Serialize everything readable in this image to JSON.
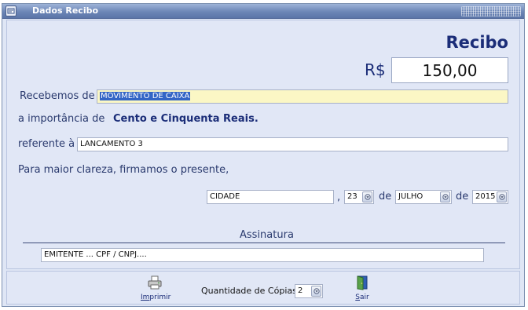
{
  "window": {
    "title": "Dados Recibo"
  },
  "header": {
    "heading": "Recibo",
    "currency_symbol": "R$",
    "amount": "150,00"
  },
  "form": {
    "received_from_label": "Recebemos de",
    "received_from_value": "MOVIMENTO DE CAIXA",
    "importance_label": "a importância de",
    "amount_in_words": "Cento e Cinquenta Reais.",
    "referring_label": "referente à",
    "referring_value": "LANCAMENTO 3",
    "clarity_text": "Para maior clareza, firmamos o presente,"
  },
  "date_line": {
    "city": "CIDADE",
    "comma": ",",
    "day": "23",
    "de1": "de",
    "month": "JULHO",
    "de2": "de",
    "year": "2015"
  },
  "signature": {
    "title": "Assinatura",
    "issuer": "EMITENTE ...  CPF / CNPJ...."
  },
  "footer": {
    "print_label_underlined": "Im",
    "print_label_rest": "primir",
    "copies_label": "Quantidade de Cópias",
    "copies_value": "2",
    "exit_label_underlined": "S",
    "exit_label_rest": "air"
  },
  "colors": {
    "accent": "#1b2d78",
    "highlight_field": "#fbf7c5",
    "selection": "#3365c6"
  }
}
